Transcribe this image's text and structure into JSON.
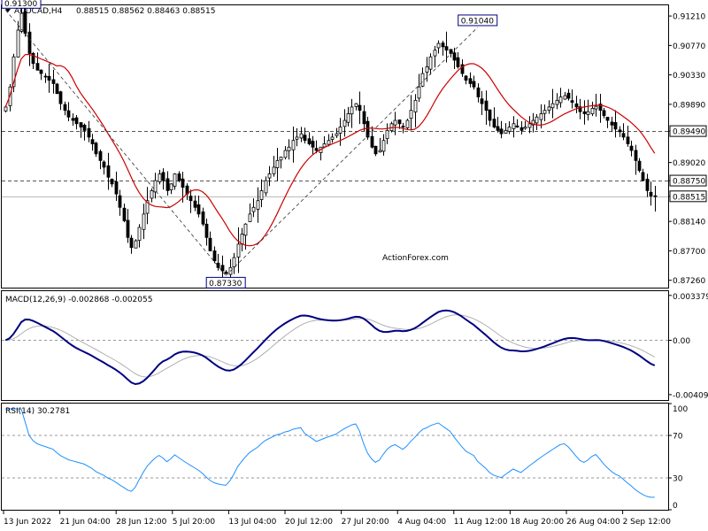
{
  "header": {
    "symbol": "AUDCAD,H4",
    "ohlc": "0.88515 0.88562 0.88463 0.88515"
  },
  "watermark": "ActionForex.com",
  "colors": {
    "candles": "#000000",
    "ma": "#cc0000",
    "macd_main": "#000080",
    "macd_signal": "#b0b0b0",
    "rsi": "#1e90ff",
    "dashed": "#555555"
  },
  "chart_data": [
    {
      "type": "candlestick",
      "title": "AUDCAD,H4",
      "ylim": [
        0.8715,
        0.9137
      ],
      "y_ticks": [
        "0.91210",
        "0.90770",
        "0.90330",
        "0.89890",
        "0.89490",
        "0.89020",
        "0.88750",
        "0.88515",
        "0.88140",
        "0.87700",
        "0.87260"
      ],
      "y_tick_values": [
        0.9121,
        0.9077,
        0.9033,
        0.8989,
        0.8949,
        0.8902,
        0.8875,
        0.88515,
        0.8814,
        0.877,
        0.8726
      ],
      "highlighted_levels": [
        {
          "label": "0.89490",
          "value": 0.8949
        },
        {
          "label": "0.88750",
          "value": 0.8875
        },
        {
          "label": "0.88515",
          "value": 0.88515
        }
      ],
      "annotations": [
        {
          "label": "0.91300",
          "value": 0.913,
          "index": 0
        },
        {
          "label": "0.91040",
          "value": 0.9104,
          "index": 120
        },
        {
          "label": "0.87330",
          "value": 0.8733,
          "index": 56
        }
      ],
      "x_ticks": [
        "13 Jun 2022",
        "21 Jun 04:00",
        "28 Jun 12:00",
        "5 Jul 20:00",
        "13 Jul 04:00",
        "20 Jul 12:00",
        "27 Jul 20:00",
        "4 Aug 04:00",
        "11 Aug 12:00",
        "18 Aug 20:00",
        "26 Aug 04:00",
        "2 Sep 12:00"
      ],
      "close": [
        0.8985,
        0.9015,
        0.906,
        0.91,
        0.9125,
        0.9095,
        0.9065,
        0.905,
        0.904,
        0.9035,
        0.903,
        0.9025,
        0.902,
        0.9005,
        0.899,
        0.898,
        0.897,
        0.8965,
        0.896,
        0.8955,
        0.895,
        0.894,
        0.893,
        0.8915,
        0.8905,
        0.8895,
        0.888,
        0.887,
        0.8855,
        0.8835,
        0.8815,
        0.879,
        0.8775,
        0.8785,
        0.8805,
        0.8825,
        0.8845,
        0.886,
        0.8875,
        0.8885,
        0.8875,
        0.886,
        0.887,
        0.8885,
        0.8875,
        0.8865,
        0.8855,
        0.8845,
        0.8835,
        0.8825,
        0.881,
        0.879,
        0.877,
        0.8755,
        0.8745,
        0.874,
        0.8736,
        0.8745,
        0.876,
        0.878,
        0.8795,
        0.881,
        0.8825,
        0.8835,
        0.8845,
        0.886,
        0.8875,
        0.8885,
        0.8895,
        0.8905,
        0.891,
        0.892,
        0.8925,
        0.8935,
        0.894,
        0.8945,
        0.8935,
        0.893,
        0.8925,
        0.892,
        0.8925,
        0.893,
        0.8935,
        0.894,
        0.8945,
        0.8955,
        0.8965,
        0.8975,
        0.8985,
        0.899,
        0.898,
        0.896,
        0.894,
        0.8925,
        0.8915,
        0.892,
        0.8935,
        0.895,
        0.896,
        0.8965,
        0.896,
        0.8955,
        0.8965,
        0.898,
        0.8995,
        0.9015,
        0.9035,
        0.9045,
        0.906,
        0.907,
        0.908,
        0.9075,
        0.907,
        0.9065,
        0.9055,
        0.9045,
        0.9035,
        0.9025,
        0.902,
        0.9015,
        0.9,
        0.899,
        0.898,
        0.8965,
        0.8955,
        0.895,
        0.8945,
        0.895,
        0.8955,
        0.896,
        0.8955,
        0.895,
        0.8955,
        0.896,
        0.8965,
        0.897,
        0.8975,
        0.898,
        0.8985,
        0.899,
        0.8995,
        0.9,
        0.9002,
        0.8998,
        0.8992,
        0.8985,
        0.8978,
        0.8975,
        0.8978,
        0.8983,
        0.8986,
        0.898,
        0.8972,
        0.8965,
        0.8958,
        0.8952,
        0.8948,
        0.894,
        0.893,
        0.892,
        0.8905,
        0.889,
        0.8875,
        0.886,
        0.8852,
        0.8852
      ]
    },
    {
      "type": "line",
      "title": "MACD(12,26,9) -0.002868 -0.002055",
      "ylim": [
        -0.0045,
        0.0037
      ],
      "y_ticks": [
        "0.003379",
        "0.00",
        "-0.004095"
      ],
      "y_tick_values": [
        0.003379,
        0.0,
        -0.004095
      ],
      "reference_lines": [
        0.0
      ]
    },
    {
      "type": "line",
      "title": "RSI(14) 30.2781",
      "ylim": [
        0,
        100
      ],
      "y_ticks": [
        "100",
        "70",
        "30",
        "0"
      ],
      "y_tick_values": [
        100,
        70,
        30,
        0
      ],
      "reference_lines": [
        70,
        30
      ]
    }
  ]
}
